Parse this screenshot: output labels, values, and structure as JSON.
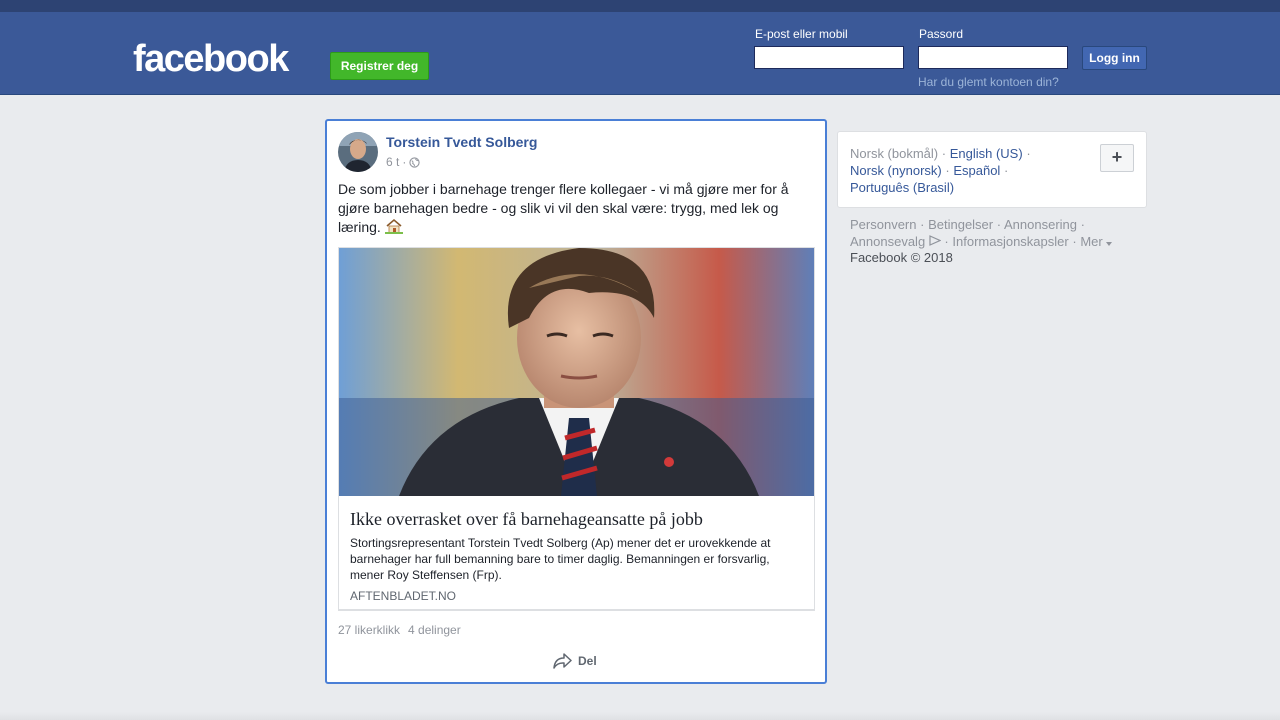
{
  "header": {
    "logo": "facebook",
    "register_label": "Registrer deg",
    "email_label": "E-post eller mobil",
    "email_value": "",
    "password_label": "Passord",
    "password_value": "",
    "login_label": "Logg inn",
    "forgot_label": "Har du glemt kontoen din?"
  },
  "post": {
    "author": "Torstein Tvedt Solberg",
    "time": "6 t",
    "separator": "·",
    "privacy_icon": "globe-icon",
    "text": "De som jobber i barnehage trenger flere kollegaer - vi må gjøre mer for å gjøre barnehagen bedre - og slik vi vil den skal være: trygg, med lek og læring.",
    "link": {
      "title": "Ikke overrasket over få barnehageansatte på jobb",
      "description": "Stortingsrepresentant Torstein Tvedt Solberg (Ap) mener det er urovekkende at barnehager har full bemanning bare to timer daglig. Bemanningen er forsvarlig, mener Roy Steffensen (Frp).",
      "domain": "AFTENBLADET.NO"
    },
    "likes": "27 likerklikk",
    "shares": "4 delinger",
    "share_label": "Del"
  },
  "languages": {
    "current": "Norsk (bokmål)",
    "dot": "·",
    "options": [
      "English (US)",
      "Norsk (nynorsk)",
      "Español",
      "Português (Brasil)"
    ],
    "more_label": "+"
  },
  "footer": {
    "links": [
      "Personvern",
      "Betingelser",
      "Annonsering",
      "Annonsevalg",
      "Informasjonskapsler",
      "Mer"
    ],
    "copyright": "Facebook © 2018"
  },
  "colors": {
    "brand": "#3b5998",
    "register": "#42b72a",
    "link": "#365899",
    "focus": "#4a7fd6"
  }
}
